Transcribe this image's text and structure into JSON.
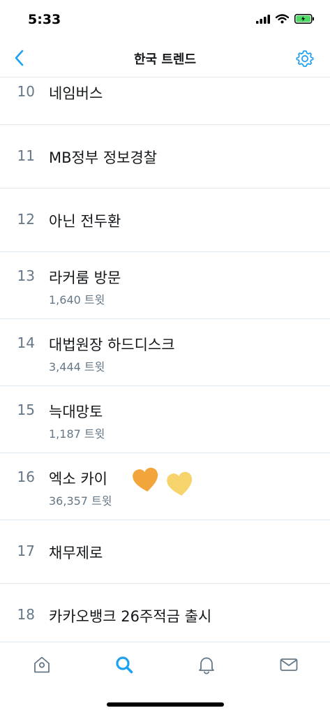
{
  "status_bar": {
    "time": "5:33"
  },
  "nav": {
    "title": "한국 트렌드",
    "back_icon": "chevron-left-icon",
    "settings_icon": "gear-icon"
  },
  "trends": [
    {
      "rank": "10",
      "name": "네임버스",
      "count": ""
    },
    {
      "rank": "11",
      "name": "MB정부 정보경찰",
      "count": ""
    },
    {
      "rank": "12",
      "name": "아닌 전두환",
      "count": ""
    },
    {
      "rank": "13",
      "name": "라커룸 방문",
      "count": "1,640 트윗"
    },
    {
      "rank": "14",
      "name": "대법원장 하드디스크",
      "count": "3,444 트윗"
    },
    {
      "rank": "15",
      "name": "늑대망토",
      "count": "1,187 트윗"
    },
    {
      "rank": "16",
      "name": "엑소 카이",
      "count": "36,357 트윗"
    },
    {
      "rank": "17",
      "name": "채무제로",
      "count": ""
    },
    {
      "rank": "18",
      "name": "카카오뱅크 26주적금 출시",
      "count": ""
    }
  ],
  "tabs": [
    {
      "icon": "home-icon"
    },
    {
      "icon": "search-icon"
    },
    {
      "icon": "bell-icon"
    },
    {
      "icon": "mail-icon"
    }
  ],
  "colors": {
    "accent": "#1da1f2",
    "muted": "#657786",
    "heart_orange": "#f2a53a",
    "heart_yellow": "#f7d36b"
  }
}
